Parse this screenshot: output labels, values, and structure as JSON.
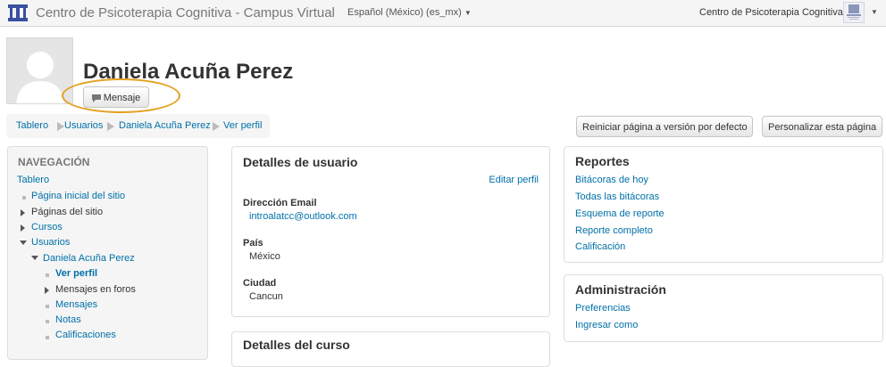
{
  "header": {
    "site_title": "Centro de Psicoterapia Cognitiva - Campus Virtual",
    "language": "Español (México) (es_mx)",
    "user_site": "Centro de Psicoterapia Cognitiva"
  },
  "profile": {
    "name": "Daniela Acuña Perez",
    "message_button": "Mensaje"
  },
  "breadcrumb": [
    "Tablero",
    "Usuarios",
    "Daniela Acuña Perez",
    "Ver perfil"
  ],
  "page_actions": {
    "reset": "Reiniciar página a versión por defecto",
    "customize": "Personalizar esta página"
  },
  "navigation": {
    "title": "NAVEGACIÓN",
    "dashboard": "Tablero",
    "items": [
      {
        "label": "Página inicial del sitio",
        "icon": "bullet",
        "is_link": true
      },
      {
        "label": "Páginas del sitio",
        "icon": "collapsed-arrow",
        "is_link": false
      },
      {
        "label": "Cursos",
        "icon": "collapsed-arrow",
        "is_link": true
      },
      {
        "label": "Usuarios",
        "icon": "expanded-arrow",
        "is_link": true
      },
      {
        "label": "Daniela Acuña Perez",
        "icon": "expanded-arrow",
        "is_link": true
      },
      {
        "label": "Ver perfil",
        "icon": "bullet",
        "is_link": true,
        "current": true
      },
      {
        "label": "Mensajes en foros",
        "icon": "collapsed-arrow",
        "is_link": false
      },
      {
        "label": "Mensajes",
        "icon": "bullet",
        "is_link": true
      },
      {
        "label": "Notas",
        "icon": "bullet",
        "is_link": true
      },
      {
        "label": "Calificaciones",
        "icon": "bullet",
        "is_link": true
      }
    ]
  },
  "user_details": {
    "title": "Detalles de usuario",
    "edit_link": "Editar perfil",
    "fields": [
      {
        "label": "Dirección Email",
        "value": "introalatcc@outlook.com",
        "is_link": true
      },
      {
        "label": "País",
        "value": "México",
        "is_link": false
      },
      {
        "label": "Ciudad",
        "value": "Cancun",
        "is_link": false
      }
    ]
  },
  "course_details": {
    "title": "Detalles del curso"
  },
  "reports": {
    "title": "Reportes",
    "links": [
      "Bitácoras de hoy",
      "Todas las bitácoras",
      "Esquema de reporte",
      "Reporte completo",
      "Calificación"
    ]
  },
  "admin": {
    "title": "Administración",
    "links": [
      "Preferencias",
      "Ingresar como"
    ]
  },
  "colors": {
    "link": "#0070a8",
    "highlight": "#e4a020"
  }
}
